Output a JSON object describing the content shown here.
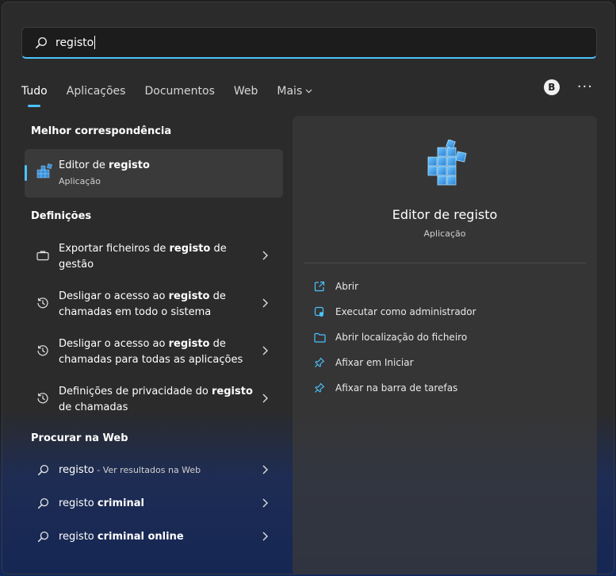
{
  "search": {
    "value": "registo"
  },
  "tabs": [
    {
      "label": "Tudo",
      "active": true
    },
    {
      "label": "Aplicações"
    },
    {
      "label": "Documentos"
    },
    {
      "label": "Web"
    },
    {
      "label": "Mais"
    }
  ],
  "account": {
    "initial": "B"
  },
  "best_match": {
    "section_title": "Melhor correspondência",
    "title_prefix": "Editor de ",
    "title_bold": "registo",
    "subtitle": "Aplicação"
  },
  "settings": {
    "section_title": "Definições",
    "items": [
      {
        "icon": "briefcase-icon",
        "pre": "Exportar ficheiros de ",
        "bold": "registo",
        "post": " de gestão"
      },
      {
        "icon": "history-icon",
        "pre": "Desligar o acesso ao ",
        "bold": "registo",
        "post": " de chamadas em todo o sistema"
      },
      {
        "icon": "history-icon",
        "pre": "Desligar o acesso ao ",
        "bold": "registo",
        "post": " de chamadas para todas as aplicações"
      },
      {
        "icon": "history-icon",
        "pre": "Definições de privacidade do ",
        "bold": "registo",
        "post": " de chamadas"
      }
    ]
  },
  "web": {
    "section_title": "Procurar na Web",
    "items": [
      {
        "pre": "registo",
        "bold": "",
        "small": " - Ver resultados na Web"
      },
      {
        "pre": "registo ",
        "bold": "criminal",
        "small": ""
      },
      {
        "pre": "registo ",
        "bold": "criminal online",
        "small": ""
      }
    ]
  },
  "detail": {
    "title": "Editor de registo",
    "subtitle": "Aplicação",
    "actions": [
      {
        "icon": "open-icon",
        "label": "Abrir"
      },
      {
        "icon": "shield-admin-icon",
        "label": "Executar como administrador"
      },
      {
        "icon": "folder-icon",
        "label": "Abrir localização do ficheiro"
      },
      {
        "icon": "pin-icon",
        "label": "Afixar em Iniciar"
      },
      {
        "icon": "pin-icon",
        "label": "Afixar na barra de tarefas"
      }
    ]
  },
  "colors": {
    "accent": "#4cc2ff",
    "registry_blue": "#3b8fd6"
  }
}
